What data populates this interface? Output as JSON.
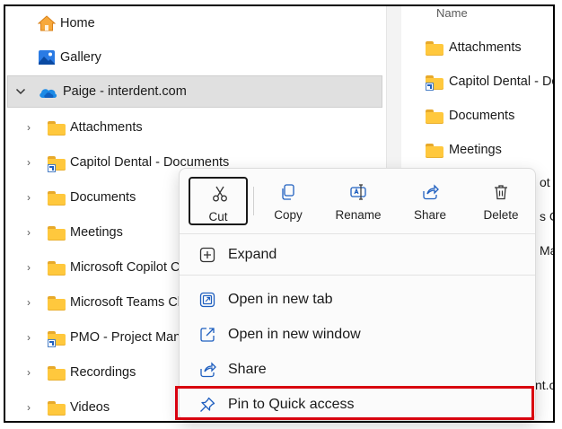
{
  "nav": {
    "items": [
      {
        "label": "Home",
        "icon": "home-icon",
        "expandable": false
      },
      {
        "label": "Gallery",
        "icon": "gallery-icon",
        "expandable": false
      },
      {
        "label": "Paige - interdent.com",
        "icon": "onedrive-cloud-icon",
        "expandable": true,
        "expanded": true,
        "selected": true
      },
      {
        "label": "Attachments",
        "icon": "folder-icon",
        "expandable": true
      },
      {
        "label": "Capitol Dental - Documents",
        "icon": "shortcut-folder-icon",
        "expandable": true
      },
      {
        "label": "Documents",
        "icon": "folder-icon",
        "expandable": true
      },
      {
        "label": "Meetings",
        "icon": "folder-icon",
        "expandable": true
      },
      {
        "label": "Microsoft Copilot C",
        "icon": "folder-icon",
        "expandable": true
      },
      {
        "label": "Microsoft Teams Ch",
        "icon": "folder-icon",
        "expandable": true
      },
      {
        "label": "PMO - Project Mana",
        "icon": "shortcut-folder-icon",
        "expandable": true
      },
      {
        "label": "Recordings",
        "icon": "folder-icon",
        "expandable": true
      },
      {
        "label": "Videos",
        "icon": "folder-icon",
        "expandable": true
      }
    ]
  },
  "content": {
    "column_header": "Name",
    "items": [
      {
        "label": "Attachments",
        "icon": "folder-icon"
      },
      {
        "label": "Capitol Dental - Do",
        "icon": "shortcut-folder-icon"
      },
      {
        "label": "Documents",
        "icon": "folder-icon"
      },
      {
        "label": "Meetings",
        "icon": "folder-icon"
      }
    ],
    "peek_fragments": [
      "ot C",
      "s C",
      "Man",
      "nt.co"
    ]
  },
  "context_menu": {
    "toolbar": [
      {
        "label": "Cut",
        "icon": "scissors-icon",
        "focused": true
      },
      {
        "label": "Copy",
        "icon": "copy-icon"
      },
      {
        "label": "Rename",
        "icon": "rename-icon"
      },
      {
        "label": "Share",
        "icon": "share-icon"
      },
      {
        "label": "Delete",
        "icon": "trash-icon"
      }
    ],
    "items": [
      {
        "label": "Expand",
        "icon": "expand-plus-icon"
      },
      {
        "label": "Open in new tab",
        "icon": "open-new-tab-icon"
      },
      {
        "label": "Open in new window",
        "icon": "open-new-window-icon"
      },
      {
        "label": "Share",
        "icon": "share-icon"
      },
      {
        "label": "Pin to Quick access",
        "icon": "pin-icon",
        "highlighted": true
      }
    ]
  },
  "colors": {
    "accent": "#0f6cbd",
    "selection": "#e0e0e0",
    "folder": "#ffc83d",
    "highlight_border": "#d9000f"
  }
}
